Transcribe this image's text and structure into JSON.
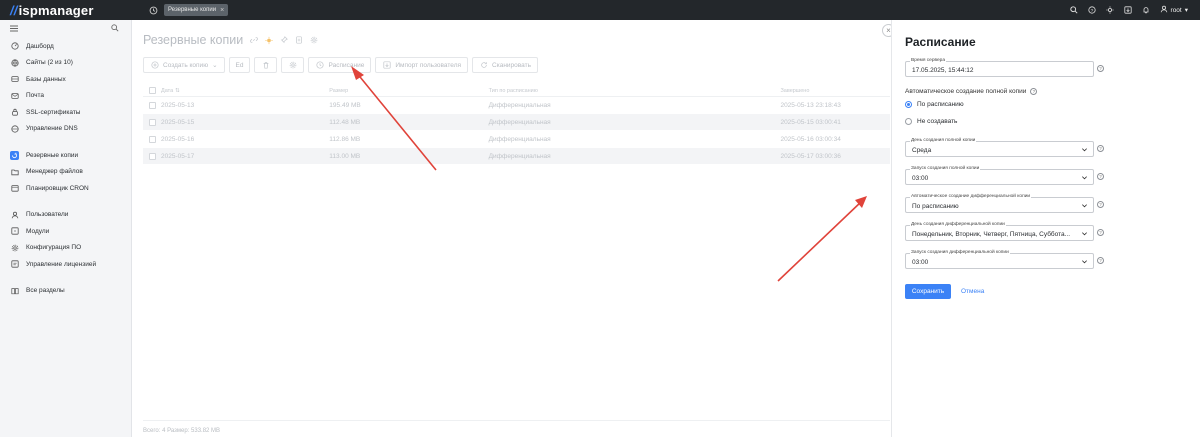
{
  "topbar": {
    "logo_slash": "//",
    "logo_text": "ispmanager",
    "tab_label": "Резервные копии",
    "user_label": "root"
  },
  "sidebar": {
    "items": [
      {
        "label": "Дашборд",
        "icon": "dashboard-icon"
      },
      {
        "label": "Сайты (2 из 10)",
        "icon": "globe-icon"
      },
      {
        "label": "Базы данных",
        "icon": "database-icon"
      },
      {
        "label": "Почта",
        "icon": "mail-icon"
      },
      {
        "label": "SSL-сертификаты",
        "icon": "lock-icon"
      },
      {
        "label": "Управление DNS",
        "icon": "dns-icon"
      },
      {
        "label": "Резервные копии",
        "icon": "backup-icon",
        "active": true
      },
      {
        "label": "Менеджер файлов",
        "icon": "folder-icon"
      },
      {
        "label": "Планировщик CRON",
        "icon": "calendar-icon"
      },
      {
        "label": "Пользователи",
        "icon": "user-icon"
      },
      {
        "label": "Модули",
        "icon": "modules-icon"
      },
      {
        "label": "Конфигурация ПО",
        "icon": "gear-icon"
      },
      {
        "label": "Управление лицензией",
        "icon": "license-icon"
      },
      {
        "label": "Все разделы",
        "icon": "book-icon"
      }
    ]
  },
  "main": {
    "title": "Резервные копии",
    "toolbar": {
      "create": "Создать копию",
      "edit": "Ed",
      "schedule": "Расписание",
      "import": "Импорт пользователя",
      "scan": "Сканировать"
    },
    "table": {
      "headers": {
        "date": "Дата",
        "size": "Размер",
        "type": "Тип по расписанию",
        "done": "Завершено"
      },
      "rows": [
        {
          "date": "2025-05-13",
          "size": "195.49 MB",
          "type": "Дифференциальная",
          "done": "2025-05-13 23:18:43"
        },
        {
          "date": "2025-05-15",
          "size": "112.48 MB",
          "type": "Дифференциальная",
          "done": "2025-05-15 03:00:41"
        },
        {
          "date": "2025-05-16",
          "size": "112.86 MB",
          "type": "Дифференциальная",
          "done": "2025-05-16 03:00:34"
        },
        {
          "date": "2025-05-17",
          "size": "113.00 MB",
          "type": "Дифференциальная",
          "done": "2025-05-17 03:00:36"
        }
      ]
    },
    "footer": "Всего: 4   Размер: 533.82 MB"
  },
  "panel": {
    "title": "Расписание",
    "server_time_label": "Время сервера",
    "server_time_value": "17.05.2025, 15:44:12",
    "auto_full_label": "Автоматическое создание полной копии",
    "radio_schedule": "По расписанию",
    "radio_none": "Не создавать",
    "full_day_label": "День создания полной копии",
    "full_day_value": "Среда",
    "full_time_label": "Запуск создания полной копии",
    "full_time_value": "03:00",
    "auto_diff_label": "Автоматическое создание дифференциальной копии",
    "auto_diff_value": "По расписанию",
    "diff_day_label": "День создания дифференциальной копии",
    "diff_day_value": "Понедельник, Вторник, Четверг, Пятница, Суббота...",
    "diff_time_label": "Запуск создания дифференциальной копии",
    "diff_time_value": "03:00",
    "save": "Сохранить",
    "cancel": "Отмена"
  },
  "colors": {
    "accent": "#3b82f6",
    "topbar": "#23272b",
    "arrow": "#e0433a"
  }
}
